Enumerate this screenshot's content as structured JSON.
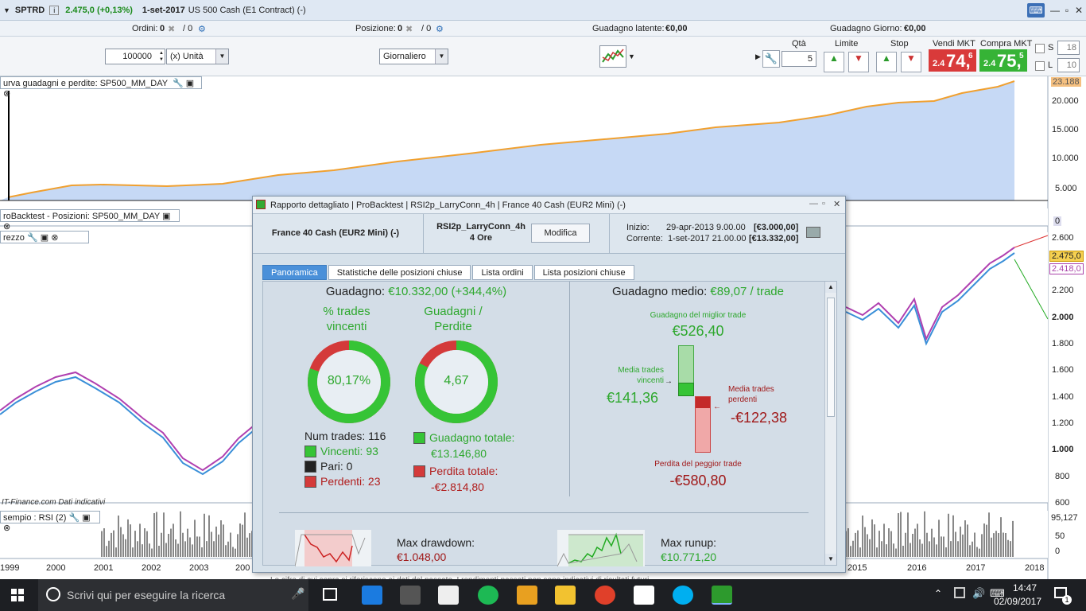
{
  "titlebar": {
    "symbol": "SPTRD",
    "price": "2.475,0 (+0,13%)",
    "date": "1-set-2017",
    "instrument": "US 500 Cash (E1 Contract) (-)"
  },
  "orderbar": {
    "orders_label": "Ordini:",
    "orders_value": "0",
    "orders_total": "/ 0",
    "position_label": "Posizione:",
    "position_value": "0",
    "position_total": "/ 0",
    "latent_label": "Guadagno latente:",
    "latent_value": "€0,00",
    "day_label": "Guadagno Giorno:",
    "day_value": "€0,00"
  },
  "toolbar": {
    "quantity_input": "100000",
    "unit_select": "(x) Unità",
    "timeframe_select": "Giornaliero",
    "qty_header": "Qtà",
    "qty_value": "5",
    "limit_header": "Limite",
    "stop_header": "Stop",
    "sell_header": "Vendi MKT",
    "buy_header": "Compra MKT",
    "sell_small": "2.4",
    "sell_big": "74,",
    "sell_sup": "6",
    "buy_small": "2.4",
    "buy_big": "75,",
    "buy_sup": "5",
    "s_label": "S",
    "s_value": "18",
    "l_label": "L",
    "l_value": "10",
    "colors": {
      "sell": "#d93a3a",
      "buy": "#36b336"
    }
  },
  "panels": {
    "equity_title": "urva guadagni e perdite: SP500_MM_DAY",
    "equity_last": "23.188",
    "equity_axis": [
      "20.000",
      "15.000",
      "10.000",
      "5.000"
    ],
    "positions_title": "roBacktest - Posizioni: SP500_MM_DAY",
    "positions_axis": "0",
    "price_title": "rezzo",
    "price_axis": [
      "2.600",
      "2.400",
      "2.200",
      "2.000",
      "1.800",
      "1.600",
      "1.400",
      "1.200",
      "1.000",
      "800",
      "600"
    ],
    "price_marks": [
      "2.475,0",
      "2.418,0"
    ],
    "rsi_title": "sempio : RSI (2)",
    "rsi_axis": [
      "95,127",
      "50",
      "0"
    ],
    "footer_source": "IT-Finance.com  Dati indicativi",
    "years": [
      "1999",
      "2000",
      "2001",
      "2002",
      "2003",
      "200",
      "2015",
      "2016",
      "2017",
      "2018"
    ]
  },
  "dialog": {
    "title": "Rapporto dettagliato | ProBacktest | RSI2p_LarryConn_4h | France 40 Cash (EUR2 Mini) (-)",
    "instrument": "France 40 Cash (EUR2 Mini) (-)",
    "strategy": "RSI2p_LarryConn_4h",
    "timeframe": "4 Ore",
    "modify_button": "Modifica",
    "start_label": "Inizio:",
    "start_date": "29-apr-2013 9.00.00",
    "start_capital": "[€3.000,00]",
    "current_label": "Corrente:",
    "current_date": "1-set-2017 21.00.00",
    "current_capital": "[€13.332,00]",
    "tabs": [
      "Panoramica",
      "Statistiche delle posizioni chiuse",
      "Lista ordini",
      "Lista posizioni chiuse"
    ],
    "gain_label": "Guadagno:",
    "gain_value": "€10.332,00 (+344,4%)",
    "pct_win_title": "% trades vincenti",
    "pct_win_value": "80,17%",
    "pct_win_fraction": 0.8017,
    "gl_title": "Guadagni / Perdite",
    "gl_value": "4,67",
    "gl_fraction": 0.8236,
    "num_trades": "Num trades: 116",
    "winners": "Vincenti: 93",
    "even": "Pari: 0",
    "losers": "Perdenti: 23",
    "total_gain_label": "Guadagno totale:",
    "total_gain_value": "€13.146,80",
    "total_loss_label": "Perdita totale:",
    "total_loss_value": "-€2.814,80",
    "avg_gain_label": "Guadagno medio:",
    "avg_gain_value": "€89,07 / trade",
    "best_trade_label": "Guadagno del miglior trade",
    "best_trade_value": "€526,40",
    "avg_win_label": "Media trades vincenti",
    "avg_win_value": "€141,36",
    "avg_loss_label": "Media trades perdenti",
    "avg_loss_value": "-€122,38",
    "worst_trade_label": "Perdita del peggior trade",
    "worst_trade_value": "-€580,80",
    "drawdown_label": "Max drawdown:",
    "drawdown_value": "€1.048,00",
    "runup_label": "Max runup:",
    "runup_value": "€10.771,20",
    "colors": {
      "green": "#2ea82e",
      "red": "#c23030"
    }
  },
  "disclaimer": "Le cifre di cui sopra si riferiscono ai dati del passato. I rendimenti passati non sono indicativi di risultati futuri.",
  "taskbar": {
    "search_placeholder": "Scrivi qui per eseguire la ricerca",
    "time": "14:47",
    "date": "02/09/2017",
    "notification_count": "1"
  }
}
